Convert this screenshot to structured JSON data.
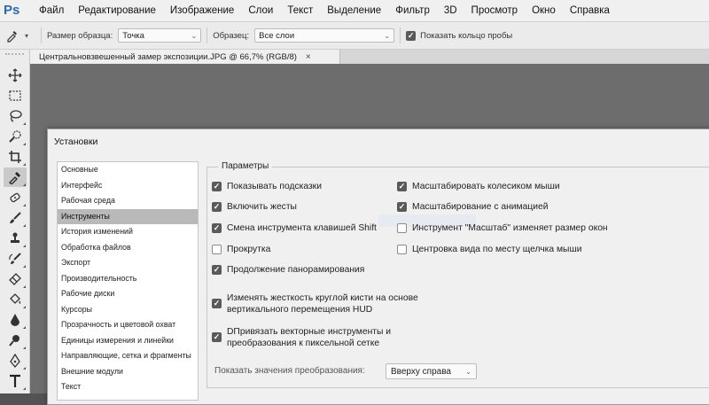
{
  "app": {
    "logo": "Ps"
  },
  "menu": [
    "Файл",
    "Редактирование",
    "Изображение",
    "Слои",
    "Текст",
    "Выделение",
    "Фильтр",
    "3D",
    "Просмотр",
    "Окно",
    "Справка"
  ],
  "options": {
    "sample_size_label": "Размер образца:",
    "sample_size_value": "Точка",
    "sample_label": "Образец:",
    "sample_value": "Все слои",
    "show_ring_label": "Показать кольцо пробы",
    "show_ring_checked": true
  },
  "document_tab": {
    "title": "Центральновзвешенный  замер экспозиции.JPG @ 66,7% (RGB/8)",
    "close": "×"
  },
  "dialog": {
    "title": "Установки",
    "categories": [
      "Основные",
      "Интерфейс",
      "Рабочая среда",
      "Инструменты",
      "История изменений",
      "Обработка файлов",
      "Экспорт",
      "Производительность",
      "Рабочие диски",
      "Курсоры",
      "Прозрачность и цветовой охват",
      "Единицы измерения и линейки",
      "Направляющие, сетка и фрагменты",
      "Внешние модули",
      "Текст"
    ],
    "selected_category": "Инструменты",
    "group_title": "Параметры",
    "options_left": [
      {
        "label": "Показывать подсказки",
        "checked": true
      },
      {
        "label": "Включить жесты",
        "checked": true
      },
      {
        "label": "Смена инструмента клавишей Shift",
        "checked": true
      },
      {
        "label": "Прокрутка",
        "checked": false
      },
      {
        "label": "Продолжение панорамирования",
        "checked": true
      }
    ],
    "options_right": [
      {
        "label": "Масштабировать колесиком мыши",
        "checked": true
      },
      {
        "label": "Масштабирование с анимацией",
        "checked": true
      },
      {
        "label": "Инструмент \"Масштаб\" изменяет размер окон",
        "checked": false
      },
      {
        "label": "Центровка вида по месту щелчка мыши",
        "checked": false
      }
    ],
    "option_hud": {
      "line1": "Изменять жесткость круглой кисти на основе",
      "line2": "вертикального перемещения HUD",
      "checked": true
    },
    "option_snap": {
      "line1": "DПривязать векторные инструменты и",
      "line2": "преобразования к пиксельной сетке",
      "checked": true
    },
    "show_transform_label": "Показать значения преобразования:",
    "show_transform_value": "Вверху справа"
  },
  "tools": [
    "move-icon",
    "marquee-icon",
    "lasso-icon",
    "quick-select-icon",
    "crop-icon",
    "eyedropper-icon",
    "healing-icon",
    "brush-icon",
    "clone-stamp-icon",
    "history-brush-icon",
    "eraser-icon",
    "paint-bucket-icon",
    "blur-icon",
    "dodge-icon",
    "pen-icon",
    "type-icon"
  ],
  "colors": {
    "accent": "#2f6aa8",
    "selected": "#b9b9b9",
    "canvas": "#6d6d6d"
  }
}
